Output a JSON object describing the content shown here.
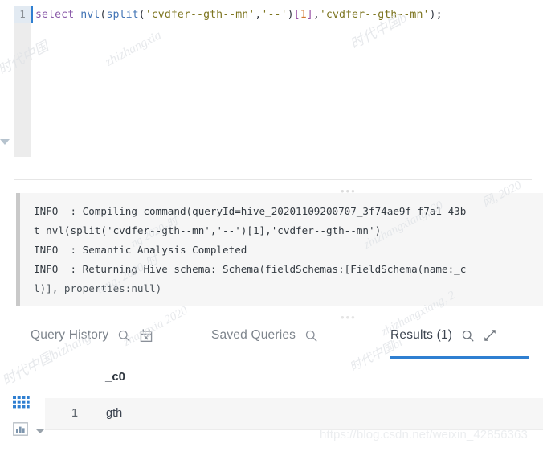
{
  "editor": {
    "line_number": "1",
    "tokens": [
      {
        "t": "select",
        "c": "kw"
      },
      {
        "t": " ",
        "c": "plain"
      },
      {
        "t": "nvl",
        "c": "fn"
      },
      {
        "t": "(",
        "c": "punct"
      },
      {
        "t": "split",
        "c": "fn"
      },
      {
        "t": "(",
        "c": "punct"
      },
      {
        "t": "'cvdfer--gth--mn'",
        "c": "str"
      },
      {
        "t": ",",
        "c": "punct"
      },
      {
        "t": "'--'",
        "c": "str"
      },
      {
        "t": ")",
        "c": "punct"
      },
      {
        "t": "[",
        "c": "brk"
      },
      {
        "t": "1",
        "c": "num"
      },
      {
        "t": "]",
        "c": "brk"
      },
      {
        "t": ",",
        "c": "punct"
      },
      {
        "t": "'cvdfer--gth--mn'",
        "c": "str"
      },
      {
        "t": ")",
        "c": "punct"
      },
      {
        "t": ";",
        "c": "punct"
      }
    ],
    "plain_text": "select nvl(split('cvdfer--gth--mn','--')[1],'cvdfer--gth--mn');"
  },
  "log": {
    "handle": "•••",
    "lines": [
      "INFO  : Compiling command(queryId=hive_20201109200707_3f74ae9f-f7a1-43b",
      "t nvl(split('cvdfer--gth--mn','--')[1],'cvdfer--gth--mn')",
      "INFO  : Semantic Analysis Completed",
      "INFO  : Returning Hive schema: Schema(fieldSchemas:[FieldSchema(name:_c",
      "l)], properties:null)"
    ]
  },
  "tabs": [
    {
      "label": "Query History",
      "active": false,
      "icons": [
        "search-icon",
        "calendar-clear-icon"
      ]
    },
    {
      "label": "Saved Queries",
      "active": false,
      "icons": [
        "search-icon"
      ]
    },
    {
      "label": "Results (1)",
      "active": true,
      "icons": [
        "search-icon",
        "expand-icon"
      ]
    }
  ],
  "results": {
    "rail_icons": [
      "grid-view-icon",
      "chart-view-icon",
      "chevron-down-icon"
    ],
    "columns": [
      "_c0"
    ],
    "rows": [
      {
        "index": "1",
        "_c0": "gth"
      }
    ]
  },
  "watermarks": {
    "cn_a": "时代中国",
    "cn_b": "zhizhangxia",
    "cn_c": "时代中国b",
    "cn_d": "网, 2020",
    "cn_e": "zhizhangxiang, 20",
    "cn_f": "ng 2020-时",
    "cn_g": "iang, 2020-时",
    "cn_h": "zhangxia 2020",
    "cn_i": "zhizhangxiang, 2",
    "cn_j": "时代中国bizhang",
    "cn_k": "时代中国bi",
    "url": "https://blog.csdn.net/weixin_42856363"
  },
  "colors": {
    "accent": "#2f7fd1",
    "keyword": "#8959a8",
    "function": "#4274b5",
    "string": "#7d7520",
    "bracket": "#9b54a8",
    "number": "#d2762c",
    "grid_icon": "#2f7fd1"
  }
}
